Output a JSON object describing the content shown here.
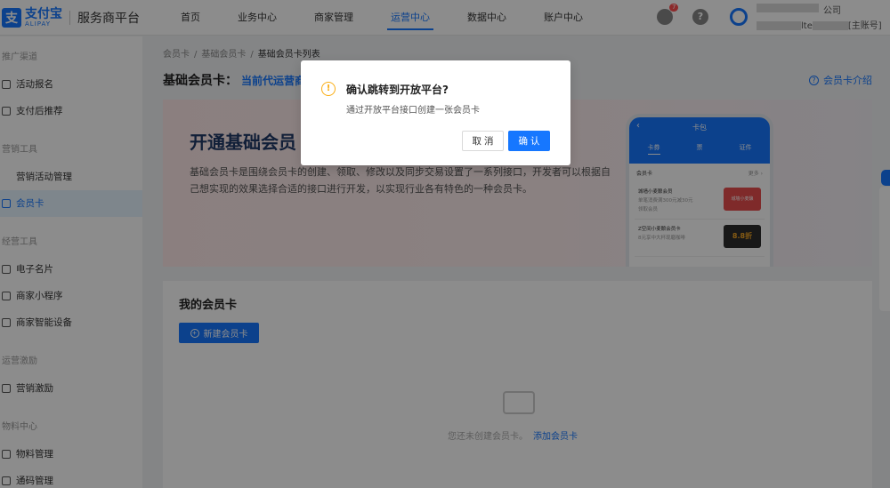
{
  "header": {
    "logo_mark": "支",
    "logo_cn": "支付宝",
    "logo_en": "ALIPAY",
    "platform": "服务商平台",
    "nav": [
      "首页",
      "业务中心",
      "商家管理",
      "运营中心",
      "数据中心",
      "账户中心"
    ],
    "active_nav_index": 3,
    "bell_badge": "7",
    "help_glyph": "?",
    "account_company_suffix": "公司",
    "account_id_suffix": "lte",
    "account_role": "[主账号]"
  },
  "sidebar": {
    "groups": [
      {
        "title": "推广渠道",
        "items": [
          {
            "label": "活动报名",
            "icon": "flag-icon"
          },
          {
            "label": "支付后推荐",
            "icon": "crown-icon"
          }
        ]
      },
      {
        "title": "营销工具",
        "items": [
          {
            "label": "营销活动管理",
            "icon": ""
          },
          {
            "label": "会员卡",
            "icon": "card-icon",
            "active": true
          }
        ]
      },
      {
        "title": "经营工具",
        "items": [
          {
            "label": "电子名片",
            "icon": "id-card-icon"
          },
          {
            "label": "商家小程序",
            "icon": "miniapp-icon"
          },
          {
            "label": "商家智能设备",
            "icon": "device-icon"
          }
        ]
      },
      {
        "title": "运营激励",
        "items": [
          {
            "label": "营销激励",
            "icon": "reward-icon"
          }
        ]
      },
      {
        "title": "物料中心",
        "items": [
          {
            "label": "物料管理",
            "icon": "layers-icon"
          },
          {
            "label": "通码管理",
            "icon": "grid-icon"
          }
        ]
      }
    ]
  },
  "breadcrumb": [
    "会员卡",
    "基础会员卡",
    "基础会员卡列表"
  ],
  "page": {
    "title": "基础会员卡：",
    "title_link": "当前代运营商",
    "intro_link": "会员卡介绍",
    "intro_icon_glyph": "?"
  },
  "banner": {
    "title": "开通基础会员",
    "desc": "基础会员卡是围绕会员卡的创建、领取、修改以及同步交易设置了一系列接口，开发者可以根据自己想实现的效果选择合适的接口进行开发，以实现行业各有特色的一种会员卡。",
    "phone": {
      "title": "卡包",
      "back_glyph": "‹",
      "tabs": [
        "卡券",
        "票",
        "证件"
      ],
      "section": "会员卡",
      "more": "更多 ›",
      "cards": [
        {
          "name": "城墙小麦酿会员",
          "sub": "单笔消费满300元减30元",
          "tag": "领取会员",
          "img": "城墙小麦酿"
        },
        {
          "name": "Z空间小麦酿会员卡",
          "sub": "8元享中大杯现磨咖啡",
          "tag": "",
          "img": "8.8折"
        }
      ]
    }
  },
  "my_cards": {
    "title": "我的会员卡",
    "new_button": "新建会员卡",
    "plus_glyph": "+",
    "empty_text": "您还未创建会员卡。",
    "empty_link": "添加会员卡"
  },
  "modal": {
    "icon_glyph": "!",
    "title": "确认跳转到开放平台?",
    "content": "通过开放平台接口创建一张会员卡",
    "cancel": "取 消",
    "ok": "确 认"
  }
}
